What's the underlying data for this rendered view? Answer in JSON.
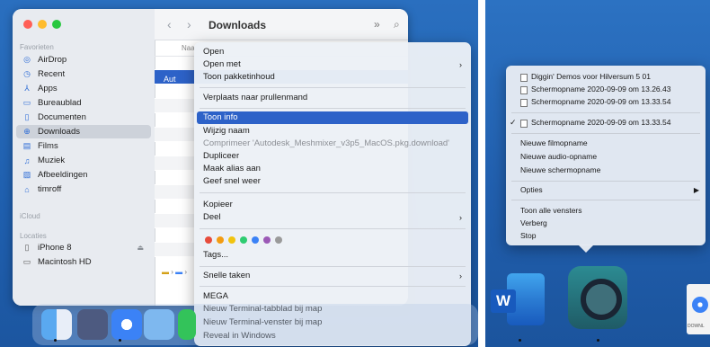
{
  "finder": {
    "title": "Downloads",
    "sidebar": {
      "favorites_header": "Favorieten",
      "items": [
        {
          "label": "AirDrop",
          "icon": "airdrop-icon"
        },
        {
          "label": "Recent",
          "icon": "clock-icon"
        },
        {
          "label": "Apps",
          "icon": "apps-icon"
        },
        {
          "label": "Bureaublad",
          "icon": "desktop-icon"
        },
        {
          "label": "Documenten",
          "icon": "document-icon"
        },
        {
          "label": "Downloads",
          "icon": "download-icon"
        },
        {
          "label": "Films",
          "icon": "film-icon"
        },
        {
          "label": "Muziek",
          "icon": "music-icon"
        },
        {
          "label": "Afbeeldingen",
          "icon": "image-icon"
        },
        {
          "label": "timroff",
          "icon": "home-icon"
        }
      ],
      "icloud_header": "iCloud",
      "locations_header": "Locaties",
      "locations": [
        {
          "label": "iPhone 8",
          "icon": "phone-icon"
        },
        {
          "label": "Macintosh HD",
          "icon": "disk-icon"
        }
      ]
    },
    "column_header": "Naa",
    "selected_file": "Aut"
  },
  "context_menu": {
    "items": [
      {
        "label": "Open"
      },
      {
        "label": "Open met",
        "submenu": true
      },
      {
        "label": "Toon pakketinhoud"
      },
      {
        "label": "Verplaats naar prullenmand"
      },
      {
        "label": "Toon info",
        "highlighted": true
      },
      {
        "label": "Wijzig naam"
      },
      {
        "label": "Comprimeer 'Autodesk_Meshmixer_v3p5_MacOS.pkg.download'",
        "disabled": true
      },
      {
        "label": "Dupliceer"
      },
      {
        "label": "Maak alias aan"
      },
      {
        "label": "Geef snel weer"
      },
      {
        "label": "Kopieer"
      },
      {
        "label": "Deel",
        "submenu": true
      },
      {
        "label": "Tags..."
      },
      {
        "label": "Snelle taken",
        "submenu": true
      },
      {
        "label": "MEGA"
      },
      {
        "label": "Nieuw Terminal-tabblad bij map"
      },
      {
        "label": "Nieuw Terminal-venster bij map"
      },
      {
        "label": "Reveal in Windows"
      }
    ],
    "tag_colors": [
      "#e74c3c",
      "#f39c12",
      "#f1c40f",
      "#2ecc71",
      "#3b82f6",
      "#9b59b6",
      "#9a9a9a"
    ]
  },
  "quicktime_menu": {
    "files": [
      "Diggin' Demos voor Hilversum 5 01",
      "Schermopname 2020-09-09 om 13.26.43",
      "Schermopname 2020-09-09 om 13.33.54"
    ],
    "checked_file": "Schermopname 2020-09-09 om 13.33.54",
    "new_items": [
      "Nieuwe filmopname",
      "Nieuwe audio-opname",
      "Nieuwe schermopname"
    ],
    "options": "Opties",
    "window_items": [
      "Toon alle vensters",
      "Verberg",
      "Stop"
    ]
  },
  "right_dock": {
    "word_letter": "W",
    "doc_label": "DOWNL"
  },
  "icons": [
    "chevron-left-icon",
    "chevron-right-icon",
    "double-chevron-icon",
    "search-icon",
    "eject-icon",
    "checkmark-icon"
  ]
}
